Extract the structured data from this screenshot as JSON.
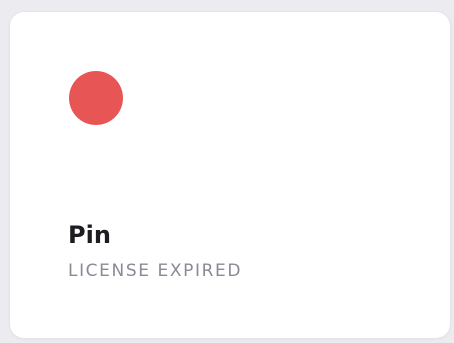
{
  "card": {
    "name": "Pin",
    "status": "LICENSE EXPIRED",
    "status_dot_color": "#e85555",
    "status_icon": "status-dot-red"
  }
}
